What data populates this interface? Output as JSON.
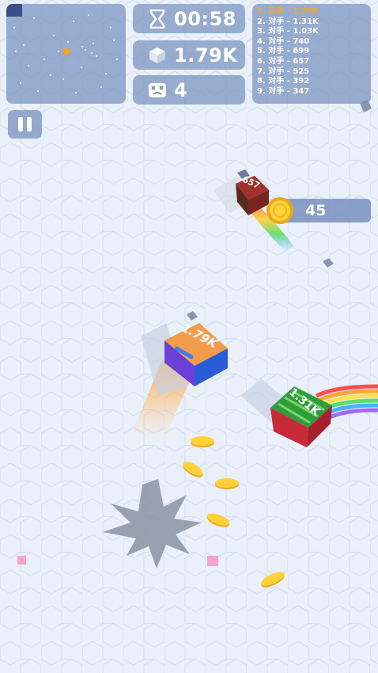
{
  "hud": {
    "timer": "00:58",
    "mass": "1.79K",
    "kills": "4"
  },
  "leaderboard": [
    {
      "label": "1. 玩家 - 1.79K",
      "is_player": true
    },
    {
      "label": "2. 对手 - 1.31K",
      "is_player": false
    },
    {
      "label": "3. 对手 - 1.03K",
      "is_player": false
    },
    {
      "label": "4. 对手 - 740",
      "is_player": false
    },
    {
      "label": "5. 对手 - 699",
      "is_player": false
    },
    {
      "label": "6. 对手 - 657",
      "is_player": false
    },
    {
      "label": "7. 对手 - 525",
      "is_player": false
    },
    {
      "label": "8. 对手 - 392",
      "is_player": false
    },
    {
      "label": "9. 对手 - 347",
      "is_player": false
    }
  ],
  "coin_reward": "45",
  "cubes": {
    "player": {
      "label": "1.79K",
      "colors": [
        "#f29b4b",
        "#6c3fd6",
        "#2a5cd8"
      ]
    },
    "enemy_red": {
      "label": "657",
      "colors": [
        "#a3312b",
        "#5a2a22"
      ]
    },
    "enemy_green": {
      "label": "1.31K",
      "colors": [
        "#2e9d3c",
        "#c92a3a"
      ]
    }
  },
  "colors": {
    "accent_gold": "#f5a623",
    "panel": "#7891be",
    "floor": "#e8eef8"
  },
  "icons": {
    "timer": "hourglass-icon",
    "mass": "cube-icon",
    "kills": "skull-icon",
    "pause": "pause-icon",
    "coin": "coin-icon"
  }
}
